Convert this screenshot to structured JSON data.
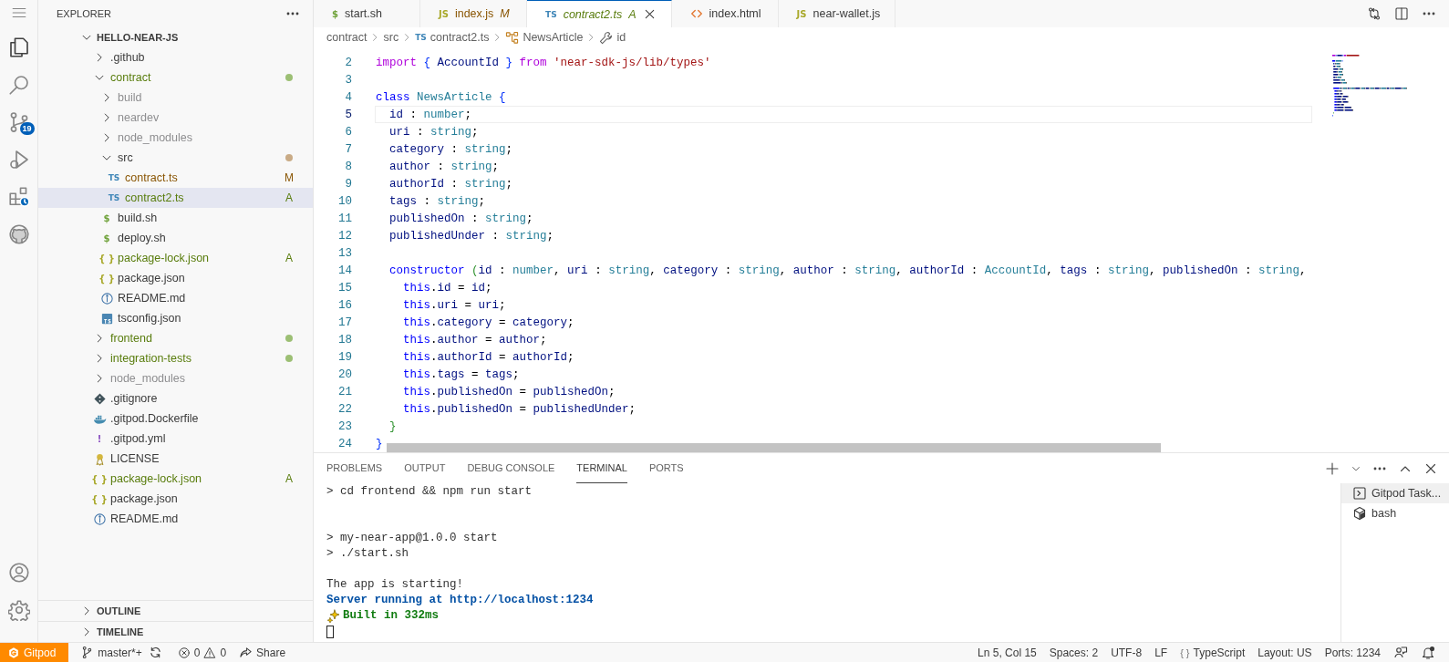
{
  "activity_bar": {
    "items": [
      {
        "kind": "explorer",
        "selected": true
      },
      {
        "kind": "search",
        "selected": false
      },
      {
        "kind": "scm",
        "selected": false,
        "badge": "19"
      },
      {
        "kind": "debug",
        "selected": false
      },
      {
        "kind": "extensions",
        "selected": false
      },
      {
        "kind": "github",
        "selected": false
      }
    ],
    "bottom": [
      {
        "kind": "account"
      },
      {
        "kind": "settings"
      }
    ]
  },
  "sidebar": {
    "title": "EXPLORER",
    "root": {
      "name": "HELLO-NEAR-JS",
      "expanded": true
    },
    "tree": [
      {
        "name": ".github",
        "kind": "folder",
        "expanded": false,
        "selected": false
      },
      {
        "name": "contract",
        "kind": "folder",
        "expanded": true,
        "added": true,
        "color": "#9cbf74",
        "selected": false,
        "children": [
          {
            "name": "build",
            "kind": "folder",
            "expanded": false,
            "ignored": true,
            "selected": false
          },
          {
            "name": "neardev",
            "kind": "folder",
            "expanded": false,
            "ignored": true,
            "selected": false
          },
          {
            "name": "node_modules",
            "kind": "folder",
            "expanded": false,
            "ignored": true,
            "selected": false
          },
          {
            "name": "src",
            "kind": "folder",
            "expanded": true,
            "color": "#c9ab86",
            "selected": false,
            "children": [
              {
                "name": "contract.ts",
                "kind": "ts",
                "glyph": "TS",
                "modified": true,
                "badge": "M",
                "selected": false
              },
              {
                "name": "contract2.ts",
                "kind": "ts",
                "glyph": "TS",
                "added": true,
                "badge": "A",
                "selected": true
              }
            ]
          },
          {
            "name": "build.sh",
            "kind": "sh",
            "glyph": "$",
            "selected": false
          },
          {
            "name": "deploy.sh",
            "kind": "sh",
            "glyph": "$",
            "selected": false
          },
          {
            "name": "package-lock.json",
            "kind": "json",
            "glyph": "{ }",
            "added": true,
            "badge": "A",
            "selected": false
          },
          {
            "name": "package.json",
            "kind": "json",
            "glyph": "{ }",
            "selected": false
          },
          {
            "name": "README.md",
            "kind": "info",
            "selected": false
          },
          {
            "name": "tsconfig.json",
            "kind": "tsconfig",
            "selected": false
          }
        ]
      },
      {
        "name": "frontend",
        "kind": "folder",
        "expanded": false,
        "added": true,
        "color": "#9cbf74",
        "selected": false
      },
      {
        "name": "integration-tests",
        "kind": "folder",
        "expanded": false,
        "added": true,
        "color": "#9cbf74",
        "selected": false
      },
      {
        "name": "node_modules",
        "kind": "folder",
        "expanded": false,
        "ignored": true,
        "selected": false
      },
      {
        "name": ".gitignore",
        "kind": "git",
        "selected": false
      },
      {
        "name": ".gitpod.Dockerfile",
        "kind": "docker",
        "selected": false
      },
      {
        "name": ".gitpod.yml",
        "kind": "yaml",
        "glyph": "!",
        "selected": false
      },
      {
        "name": "LICENSE",
        "kind": "license",
        "selected": false
      },
      {
        "name": "package-lock.json",
        "kind": "json",
        "glyph": "{ }",
        "added": true,
        "badge": "A",
        "selected": false
      },
      {
        "name": "package.json",
        "kind": "json",
        "glyph": "{ }",
        "selected": false
      },
      {
        "name": "README.md",
        "kind": "info",
        "selected": false
      }
    ],
    "sections": [
      {
        "title": "OUTLINE",
        "expanded": false
      },
      {
        "title": "TIMELINE",
        "expanded": false
      }
    ]
  },
  "tabs": [
    {
      "label": "start.sh",
      "kind": "sh",
      "glyph": "$",
      "selected": false,
      "preview": false
    },
    {
      "label": "index.js",
      "kind": "js",
      "glyph": "JS",
      "modified": true,
      "badge": "M",
      "selected": false,
      "preview": false
    },
    {
      "label": "contract2.ts",
      "kind": "ts",
      "glyph": "TS",
      "added": true,
      "badge": "A",
      "selected": true,
      "preview": true
    },
    {
      "label": "index.html",
      "kind": "html",
      "selected": false,
      "preview": false
    },
    {
      "label": "near-wallet.js",
      "kind": "js",
      "glyph": "JS",
      "selected": false,
      "preview": false
    }
  ],
  "breadcrumb": [
    {
      "label": "contract",
      "kind": "folder"
    },
    {
      "label": "src",
      "kind": "folder"
    },
    {
      "label": "contract2.ts",
      "kind": "ts",
      "glyph": "TS"
    },
    {
      "label": "NewsArticle",
      "kind": "class"
    },
    {
      "label": "id",
      "kind": "property"
    }
  ],
  "code": [
    {
      "number": "2",
      "current": false,
      "tokens": [
        {
          "text": "import",
          "kind": "ctrl"
        },
        {
          "text": " {",
          "kind": "b1"
        },
        {
          "text": " AccountId ",
          "kind": "var"
        },
        {
          "text": "}",
          "kind": "b1"
        },
        {
          "text": " from",
          "kind": "ctrl"
        },
        {
          "text": " 'near-sdk-js/lib/types'",
          "kind": "str"
        }
      ]
    },
    {
      "number": "3",
      "current": false
    },
    {
      "number": "4",
      "current": false,
      "tokens": [
        {
          "text": "class",
          "kind": "kw"
        },
        {
          "text": " NewsArticle",
          "kind": "type"
        },
        {
          "text": " {",
          "kind": "b1"
        }
      ]
    },
    {
      "number": "5",
      "current": true,
      "tokens": [
        {
          "text": "  id",
          "kind": "var"
        },
        {
          "text": " : ",
          "kind": "p"
        },
        {
          "text": "number",
          "kind": "type"
        },
        {
          "text": ";",
          "kind": "p"
        }
      ]
    },
    {
      "number": "6",
      "current": false,
      "tokens": [
        {
          "text": "  uri",
          "kind": "var"
        },
        {
          "text": " : ",
          "kind": "p"
        },
        {
          "text": "string",
          "kind": "type"
        },
        {
          "text": ";",
          "kind": "p"
        }
      ]
    },
    {
      "number": "7",
      "current": false,
      "tokens": [
        {
          "text": "  category",
          "kind": "var"
        },
        {
          "text": " : ",
          "kind": "p"
        },
        {
          "text": "string",
          "kind": "type"
        },
        {
          "text": ";",
          "kind": "p"
        }
      ]
    },
    {
      "number": "8",
      "current": false,
      "tokens": [
        {
          "text": "  author",
          "kind": "var"
        },
        {
          "text": " : ",
          "kind": "p"
        },
        {
          "text": "string",
          "kind": "type"
        },
        {
          "text": ";",
          "kind": "p"
        }
      ]
    },
    {
      "number": "9",
      "current": false,
      "tokens": [
        {
          "text": "  authorId",
          "kind": "var"
        },
        {
          "text": " : ",
          "kind": "p"
        },
        {
          "text": "string",
          "kind": "type"
        },
        {
          "text": ";",
          "kind": "p"
        }
      ]
    },
    {
      "number": "10",
      "current": false,
      "tokens": [
        {
          "text": "  tags",
          "kind": "var"
        },
        {
          "text": " : ",
          "kind": "p"
        },
        {
          "text": "string",
          "kind": "type"
        },
        {
          "text": ";",
          "kind": "p"
        }
      ]
    },
    {
      "number": "11",
      "current": false,
      "tokens": [
        {
          "text": "  publishedOn",
          "kind": "var"
        },
        {
          "text": " : ",
          "kind": "p"
        },
        {
          "text": "string",
          "kind": "type"
        },
        {
          "text": ";",
          "kind": "p"
        }
      ]
    },
    {
      "number": "12",
      "current": false,
      "tokens": [
        {
          "text": "  publishedUnder",
          "kind": "var"
        },
        {
          "text": " : ",
          "kind": "p"
        },
        {
          "text": "string",
          "kind": "type"
        },
        {
          "text": ";",
          "kind": "p"
        }
      ]
    },
    {
      "number": "13",
      "current": false
    },
    {
      "number": "14",
      "current": false,
      "tokens": [
        {
          "text": "  constructor",
          "kind": "kw"
        },
        {
          "text": " (",
          "kind": "b2"
        },
        {
          "text": "id",
          "kind": "var"
        },
        {
          "text": " : ",
          "kind": "p"
        },
        {
          "text": "number",
          "kind": "type"
        },
        {
          "text": ", ",
          "kind": "p"
        },
        {
          "text": "uri",
          "kind": "var"
        },
        {
          "text": " : ",
          "kind": "p"
        },
        {
          "text": "string",
          "kind": "type"
        },
        {
          "text": ", ",
          "kind": "p"
        },
        {
          "text": "category",
          "kind": "var"
        },
        {
          "text": " : ",
          "kind": "p"
        },
        {
          "text": "string",
          "kind": "type"
        },
        {
          "text": ", ",
          "kind": "p"
        },
        {
          "text": "author",
          "kind": "var"
        },
        {
          "text": " : ",
          "kind": "p"
        },
        {
          "text": "string",
          "kind": "type"
        },
        {
          "text": ", ",
          "kind": "p"
        },
        {
          "text": "authorId",
          "kind": "var"
        },
        {
          "text": " : ",
          "kind": "p"
        },
        {
          "text": "AccountId",
          "kind": "type"
        },
        {
          "text": ", ",
          "kind": "p"
        },
        {
          "text": "tags",
          "kind": "var"
        },
        {
          "text": " : ",
          "kind": "p"
        },
        {
          "text": "string",
          "kind": "type"
        },
        {
          "text": ", ",
          "kind": "p"
        },
        {
          "text": "publishedOn",
          "kind": "var"
        },
        {
          "text": " : ",
          "kind": "p"
        },
        {
          "text": "string",
          "kind": "type"
        },
        {
          "text": ",",
          "kind": "p"
        }
      ]
    },
    {
      "number": "15",
      "current": false,
      "tokens": [
        {
          "text": "    this",
          "kind": "kw"
        },
        {
          "text": ".",
          "kind": "p"
        },
        {
          "text": "id",
          "kind": "var"
        },
        {
          "text": " = ",
          "kind": "p"
        },
        {
          "text": "id",
          "kind": "var"
        },
        {
          "text": ";",
          "kind": "p"
        }
      ]
    },
    {
      "number": "16",
      "current": false,
      "tokens": [
        {
          "text": "    this",
          "kind": "kw"
        },
        {
          "text": ".",
          "kind": "p"
        },
        {
          "text": "uri",
          "kind": "var"
        },
        {
          "text": " = ",
          "kind": "p"
        },
        {
          "text": "uri",
          "kind": "var"
        },
        {
          "text": ";",
          "kind": "p"
        }
      ]
    },
    {
      "number": "17",
      "current": false,
      "tokens": [
        {
          "text": "    this",
          "kind": "kw"
        },
        {
          "text": ".",
          "kind": "p"
        },
        {
          "text": "category",
          "kind": "var"
        },
        {
          "text": " = ",
          "kind": "p"
        },
        {
          "text": "category",
          "kind": "var"
        },
        {
          "text": ";",
          "kind": "p"
        }
      ]
    },
    {
      "number": "18",
      "current": false,
      "tokens": [
        {
          "text": "    this",
          "kind": "kw"
        },
        {
          "text": ".",
          "kind": "p"
        },
        {
          "text": "author",
          "kind": "var"
        },
        {
          "text": " = ",
          "kind": "p"
        },
        {
          "text": "author",
          "kind": "var"
        },
        {
          "text": ";",
          "kind": "p"
        }
      ]
    },
    {
      "number": "19",
      "current": false,
      "tokens": [
        {
          "text": "    this",
          "kind": "kw"
        },
        {
          "text": ".",
          "kind": "p"
        },
        {
          "text": "authorId",
          "kind": "var"
        },
        {
          "text": " = ",
          "kind": "p"
        },
        {
          "text": "authorId",
          "kind": "var"
        },
        {
          "text": ";",
          "kind": "p"
        }
      ]
    },
    {
      "number": "20",
      "current": false,
      "tokens": [
        {
          "text": "    this",
          "kind": "kw"
        },
        {
          "text": ".",
          "kind": "p"
        },
        {
          "text": "tags",
          "kind": "var"
        },
        {
          "text": " = ",
          "kind": "p"
        },
        {
          "text": "tags",
          "kind": "var"
        },
        {
          "text": ";",
          "kind": "p"
        }
      ]
    },
    {
      "number": "21",
      "current": false,
      "tokens": [
        {
          "text": "    this",
          "kind": "kw"
        },
        {
          "text": ".",
          "kind": "p"
        },
        {
          "text": "publishedOn",
          "kind": "var"
        },
        {
          "text": " = ",
          "kind": "p"
        },
        {
          "text": "publishedOn",
          "kind": "var"
        },
        {
          "text": ";",
          "kind": "p"
        }
      ]
    },
    {
      "number": "22",
      "current": false,
      "tokens": [
        {
          "text": "    this",
          "kind": "kw"
        },
        {
          "text": ".",
          "kind": "p"
        },
        {
          "text": "publishedOn",
          "kind": "var"
        },
        {
          "text": " = ",
          "kind": "p"
        },
        {
          "text": "publishedUnder",
          "kind": "var"
        },
        {
          "text": ";",
          "kind": "p"
        }
      ]
    },
    {
      "number": "23",
      "current": false,
      "tokens": [
        {
          "text": "  }",
          "kind": "b2"
        }
      ]
    },
    {
      "number": "24",
      "current": false,
      "tokens": [
        {
          "text": "}",
          "kind": "b1"
        }
      ]
    }
  ],
  "panel": {
    "tabs": [
      {
        "label": "PROBLEMS",
        "selected": false
      },
      {
        "label": "OUTPUT",
        "selected": false
      },
      {
        "label": "DEBUG CONSOLE",
        "selected": false
      },
      {
        "label": "TERMINAL",
        "selected": true
      },
      {
        "label": "PORTS",
        "selected": false
      }
    ],
    "terminal": {
      "blocks": [
        {
          "lines": [
            {
              "kind": "plain",
              "text": "> cd frontend && npm run start"
            }
          ]
        },
        {
          "lines": [
            {
              "kind": "plain",
              "text": "> my-near-app@1.0.0 start"
            },
            {
              "kind": "plain",
              "text": "> ./start.sh"
            }
          ]
        },
        {
          "lines": [
            {
              "kind": "plain",
              "text": "The app is starting!"
            },
            {
              "kind": "link",
              "text": "Server running at http://localhost:1234"
            },
            {
              "kind": "success",
              "text": "Built in 332ms"
            },
            {
              "kind": "cursor"
            }
          ]
        }
      ]
    },
    "sessions": [
      {
        "label": "Gitpod Task...",
        "kind": "task",
        "selected": true
      },
      {
        "label": "bash",
        "kind": "shell",
        "selected": false
      }
    ]
  },
  "status_bar": {
    "left": [
      {
        "kind": "remote",
        "label": "Gitpod"
      },
      {
        "kind": "branch",
        "label": "master*+"
      },
      {
        "kind": "sync"
      },
      {
        "kind": "problems",
        "errors": "0",
        "warnings": "0"
      },
      {
        "kind": "share",
        "label": "Share"
      }
    ],
    "right": [
      {
        "kind": "text",
        "label": "Ln 5, Col 15"
      },
      {
        "kind": "text",
        "label": "Spaces: 2"
      },
      {
        "kind": "text",
        "label": "UTF-8"
      },
      {
        "kind": "text",
        "label": "LF"
      },
      {
        "kind": "language",
        "glyph": "{ }",
        "label": "TypeScript"
      },
      {
        "kind": "text",
        "label": "Layout: US"
      },
      {
        "kind": "text",
        "label": "Ports: 1234"
      },
      {
        "kind": "feedback"
      },
      {
        "kind": "bell"
      }
    ]
  }
}
